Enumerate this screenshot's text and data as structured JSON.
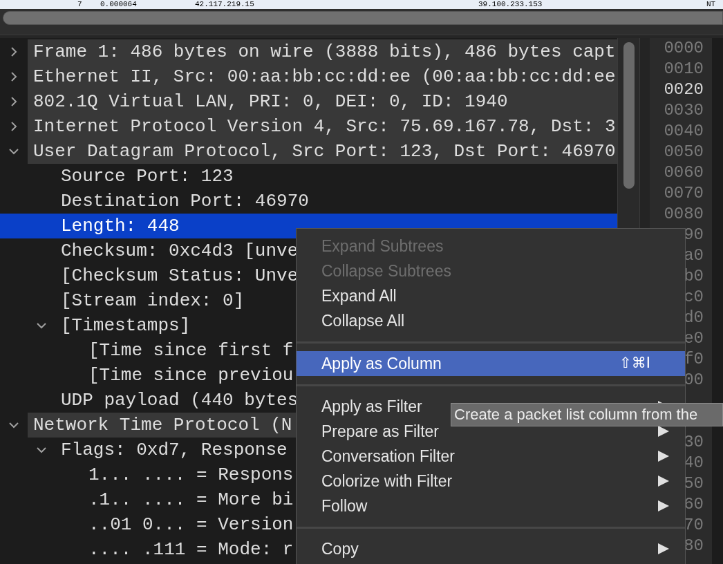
{
  "packet_list": {
    "row": [
      "7",
      "0.000064",
      "42.117.219.15",
      "39.100.233.153",
      "NT"
    ]
  },
  "tree": [
    {
      "text": "Frame 1: 486 bytes on wire (3888 bits), 486 bytes capt",
      "expanded": false,
      "selected": false
    },
    {
      "text": "Ethernet II, Src: 00:aa:bb:cc:dd:ee (00:aa:bb:cc:dd:ee",
      "expanded": false,
      "selected": false
    },
    {
      "text": "802.1Q Virtual LAN, PRI: 0, DEI: 0, ID: 1940",
      "expanded": false,
      "selected": false
    },
    {
      "text": "Internet Protocol Version 4, Src: 75.69.167.78, Dst: 3",
      "expanded": false,
      "selected": false
    },
    {
      "text": "User Datagram Protocol, Src Port: 123, Dst Port: 46970",
      "expanded": true,
      "selected": false,
      "children": [
        {
          "text": "Source Port: 123",
          "selected": false
        },
        {
          "text": "Destination Port: 46970",
          "selected": false
        },
        {
          "text": "Length: 448",
          "selected": true
        },
        {
          "text": "Checksum: 0xc4d3 [unve",
          "selected": false
        },
        {
          "text": "[Checksum Status: Unve",
          "selected": false
        },
        {
          "text": "[Stream index: 0]",
          "selected": false
        },
        {
          "text": "[Timestamps]",
          "expanded": true,
          "selected": false,
          "children": [
            {
              "text": "[Time since first f",
              "selected": false
            },
            {
              "text": "[Time since previou",
              "selected": false
            }
          ]
        },
        {
          "text": "UDP payload (440 bytes",
          "selected": false
        }
      ]
    },
    {
      "text": "Network Time Protocol (N",
      "expanded": true,
      "selected": false,
      "children": [
        {
          "text": "Flags: 0xd7, Response",
          "expanded": true,
          "selected": false,
          "children": [
            {
              "text": "1... .... = Respons",
              "selected": false
            },
            {
              "text": ".1.. .... = More bi",
              "selected": false
            },
            {
              "text": "..01 0... = Version",
              "selected": false
            },
            {
              "text": ".... .111 = Mode: r",
              "selected": false
            }
          ]
        }
      ]
    }
  ],
  "hex_offsets": [
    {
      "text": "0000",
      "highlighted": false
    },
    {
      "text": "0010",
      "highlighted": false
    },
    {
      "text": "0020",
      "highlighted": true
    },
    {
      "text": "0030",
      "highlighted": false
    },
    {
      "text": "0040",
      "highlighted": false
    },
    {
      "text": "0050",
      "highlighted": false
    },
    {
      "text": "0060",
      "highlighted": false
    },
    {
      "text": "0070",
      "highlighted": false
    },
    {
      "text": "0080",
      "highlighted": false
    },
    {
      "text": "90",
      "highlighted": false
    },
    {
      "text": "a0",
      "highlighted": false
    },
    {
      "text": "b0",
      "highlighted": false
    },
    {
      "text": "c0",
      "highlighted": false
    },
    {
      "text": "d0",
      "highlighted": false
    },
    {
      "text": "e0",
      "highlighted": false
    },
    {
      "text": "f0",
      "highlighted": false
    },
    {
      "text": "00",
      "highlighted": false
    }
  ],
  "hex_offsets_below_tooltip": [
    {
      "text": "30",
      "highlighted": false
    },
    {
      "text": "40",
      "highlighted": false
    },
    {
      "text": "50",
      "highlighted": false
    },
    {
      "text": "60",
      "highlighted": false
    },
    {
      "text": "70",
      "highlighted": false
    },
    {
      "text": "80",
      "highlighted": false
    }
  ],
  "context_menu": [
    {
      "kind": "item",
      "label": "Expand Subtrees",
      "disabled": true,
      "selected": false
    },
    {
      "kind": "item",
      "label": "Collapse Subtrees",
      "disabled": true,
      "selected": false
    },
    {
      "kind": "item",
      "label": "Expand All",
      "disabled": false,
      "selected": false
    },
    {
      "kind": "item",
      "label": "Collapse All",
      "disabled": false,
      "selected": false
    },
    {
      "kind": "separator"
    },
    {
      "kind": "item",
      "label": "Apply as Column",
      "disabled": false,
      "selected": true,
      "shortcut": "⇧⌘I"
    },
    {
      "kind": "separator"
    },
    {
      "kind": "item",
      "label": "Apply as Filter",
      "disabled": false,
      "selected": false,
      "submenu": true
    },
    {
      "kind": "item",
      "label": "Prepare as Filter",
      "disabled": false,
      "selected": false,
      "submenu": true
    },
    {
      "kind": "item",
      "label": "Conversation Filter",
      "disabled": false,
      "selected": false,
      "submenu": true
    },
    {
      "kind": "item",
      "label": "Colorize with Filter",
      "disabled": false,
      "selected": false,
      "submenu": true
    },
    {
      "kind": "item",
      "label": "Follow",
      "disabled": false,
      "selected": false,
      "submenu": true
    },
    {
      "kind": "separator"
    },
    {
      "kind": "item",
      "label": "Copy",
      "disabled": false,
      "selected": false,
      "submenu": true
    }
  ],
  "tooltip": "Create a packet list column from the"
}
